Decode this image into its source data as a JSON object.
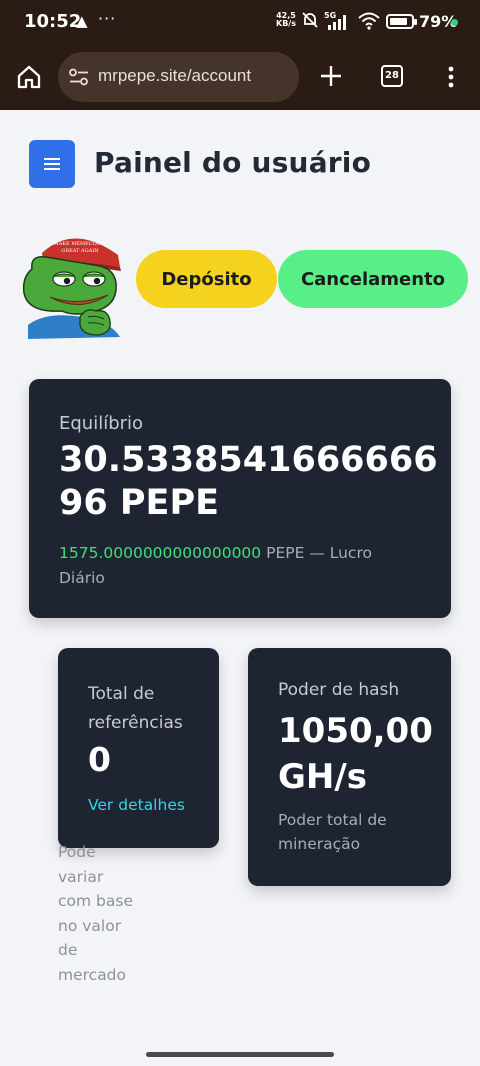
{
  "status_bar": {
    "time": "10:52",
    "warning_icon": "warning-triangle-icon",
    "more_indicator": "···",
    "net_speed_value": "42,5",
    "net_speed_unit": "KB/s",
    "network_type": "5G",
    "battery_percent": "79%",
    "battery_level": 0.79,
    "charging_dot_color": "#33d17a"
  },
  "browser": {
    "url": "mrpepe.site/account",
    "tab_count": "28"
  },
  "header": {
    "title": "Painel do usuário",
    "menu_color": "#2f6fe8"
  },
  "actions": {
    "deposit_label": "Depósito",
    "cancel_label": "Cancelamento",
    "deposit_color": "#f4d21d",
    "cancel_color": "#58ee88"
  },
  "mascot": {
    "hat_text_line1": "MAKE MEMECOINS",
    "hat_text_line2": "GREAT AGAIN"
  },
  "balance": {
    "label": "Equilíbrio",
    "value": "30.5338541666666​96 PEPE",
    "daily_profit_value": "1575.0000000000000000",
    "daily_profit_suffix": "PEPE — Lucro Diário"
  },
  "referrals": {
    "label": "Total de referências",
    "value": "0",
    "link": "Ver detalhes"
  },
  "hashpower": {
    "label": "Poder de hash",
    "value": "1050,00 GH/s",
    "subtitle": "Poder total de mineração"
  },
  "note": "Pode variar com base no valor de mercado"
}
